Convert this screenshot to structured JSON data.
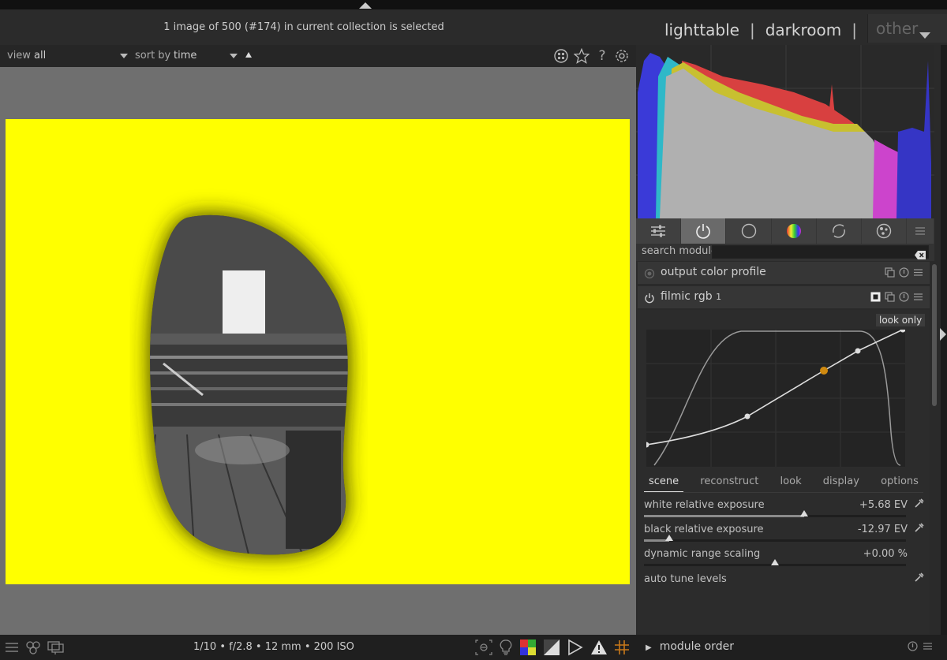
{
  "header": {
    "status": "1 image of 500 (#174) in current collection is selected",
    "views": {
      "lighttable": "lighttable",
      "sep1": "|",
      "darkroom": "darkroom",
      "sep2": "|",
      "other": "other"
    }
  },
  "filterbar": {
    "view_label": "view",
    "view_value": "all",
    "sort_label": "sort by",
    "sort_value": "time",
    "icons": [
      "overlay-icon",
      "star-icon",
      "help-icon",
      "gear-icon"
    ]
  },
  "right_panel": {
    "module_tabs": [
      "quick-access-icon",
      "active-modules-icon",
      "base-modules-icon",
      "color-modules-icon",
      "correct-modules-icon",
      "effect-modules-icon",
      "menu-icon"
    ],
    "search_label": "search module",
    "search_placeholder": "",
    "modules": [
      {
        "title": "output color profile",
        "instance": ""
      },
      {
        "title": "filmic rgb",
        "instance": "1"
      }
    ],
    "filmic": {
      "look_only": "look only",
      "tabs": [
        "scene",
        "reconstruct",
        "look",
        "display",
        "options"
      ],
      "active_tab": "scene",
      "sliders": [
        {
          "label": "white relative exposure",
          "value": "+5.68 EV",
          "position": 0.61
        },
        {
          "label": "black relative exposure",
          "value": "-12.97 EV",
          "position": 0.095
        },
        {
          "label": "dynamic range scaling",
          "value": "+0.00 %",
          "position": 0.5
        }
      ],
      "auto_tune": "auto tune levels"
    }
  },
  "bottombar": {
    "exif": "1/10 • f/2.8 • 12 mm • 200 ISO",
    "module_order": "module order"
  },
  "colors": {
    "accent_orange": "#d08a10",
    "photo_background": "#ffff00"
  }
}
